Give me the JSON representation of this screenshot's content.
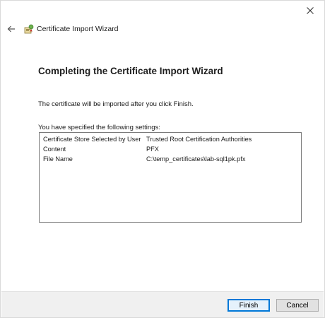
{
  "window": {
    "title": "Certificate Import Wizard"
  },
  "icons": {
    "close": "close-icon",
    "back": "back-arrow-icon",
    "wizard": "certificate-wizard-icon"
  },
  "page": {
    "heading": "Completing the Certificate Import Wizard",
    "description": "The certificate will be imported after you click Finish.",
    "settings_label": "You have specified the following settings:"
  },
  "settings": [
    {
      "key": "Certificate Store Selected by User",
      "value": "Trusted Root Certification Authorities"
    },
    {
      "key": "Content",
      "value": "PFX"
    },
    {
      "key": "File Name",
      "value": "C:\\temp_certificates\\lab-sql1pk.pfx"
    }
  ],
  "buttons": {
    "finish": "Finish",
    "cancel": "Cancel"
  },
  "colors": {
    "accent": "#0078d7"
  }
}
